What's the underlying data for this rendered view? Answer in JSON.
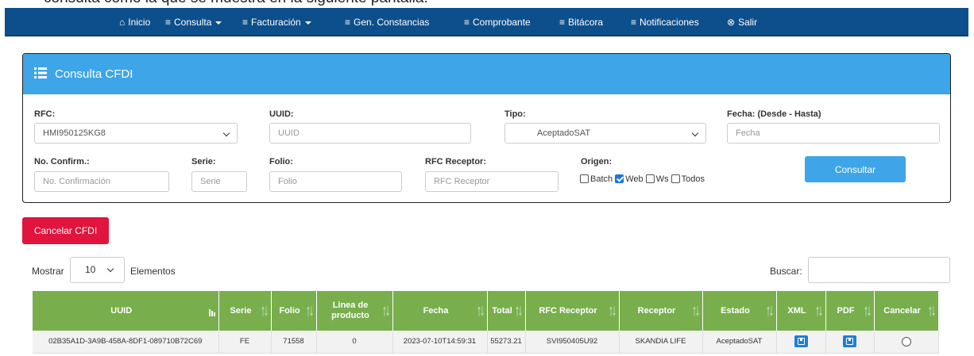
{
  "doc_text": "consulta como la que se muestra en la siguiente pantalla:",
  "nav": [
    {
      "label": "Inicio",
      "icon": "home-icon",
      "caret": false
    },
    {
      "label": "Consulta",
      "icon": "list-icon",
      "caret": true
    },
    {
      "label": "Facturación",
      "icon": "list-icon",
      "caret": true
    },
    {
      "label": "Gen. Constancias",
      "icon": "list-icon",
      "caret": false
    },
    {
      "label": "Comprobante",
      "icon": "list-icon",
      "caret": false
    },
    {
      "label": "Bitácora",
      "icon": "list-icon",
      "caret": false
    },
    {
      "label": "Notificaciones",
      "icon": "list-icon",
      "caret": false
    },
    {
      "label": "Salir",
      "icon": "close-circle-icon",
      "caret": false
    }
  ],
  "panel": {
    "title": "Consulta CFDI",
    "rfc": {
      "label": "RFC:",
      "value": "HMI950125KG8"
    },
    "uuid": {
      "label": "UUID:",
      "placeholder": "UUID"
    },
    "tipo": {
      "label": "Tipo:",
      "value": "AceptadoSAT"
    },
    "fecha": {
      "label": "Fecha: (Desde - Hasta)",
      "placeholder": "Fecha"
    },
    "confirm": {
      "label": "No. Confirm.:",
      "placeholder": "No. Confirmación"
    },
    "serie": {
      "label": "Serie:",
      "placeholder": "Serie"
    },
    "folio": {
      "label": "Folio:",
      "placeholder": "Folio"
    },
    "rfc_receptor": {
      "label": "RFC Receptor:",
      "placeholder": "RFC Receptor"
    },
    "origen": {
      "label": "Origen:",
      "options": [
        {
          "label": "Batch",
          "checked": false
        },
        {
          "label": "Web",
          "checked": true
        },
        {
          "label": "Ws",
          "checked": false
        },
        {
          "label": "Todos",
          "checked": false
        }
      ]
    },
    "consultar_label": "Consultar"
  },
  "cancel_button": "Cancelar CFDI",
  "table_controls": {
    "mostrar": "Mostrar",
    "length": "10",
    "elementos": "Elementos",
    "buscar": "Buscar:"
  },
  "table": {
    "headers": [
      "UUID",
      "Serie",
      "Folio",
      "Linea de producto",
      "Fecha",
      "Total",
      "RFC Receptor",
      "Receptor",
      "Estado",
      "XML",
      "PDF",
      "Cancelar"
    ],
    "rows": [
      [
        "02B35A1D-3A9B-458A-8DF1-089710B72C69",
        "FE",
        "71558",
        "0",
        "2023-07-10T14:59:31",
        "55273.21",
        "SVI950405U92",
        "SKANDIA LIFE",
        "AceptadoSAT"
      ]
    ]
  },
  "colors": {
    "navbar": "#0d4f8b",
    "panel_header": "#3da5e8",
    "cancel_button": "#e0143c",
    "table_header": "#78ae4c",
    "download": "#1e7fd6"
  }
}
